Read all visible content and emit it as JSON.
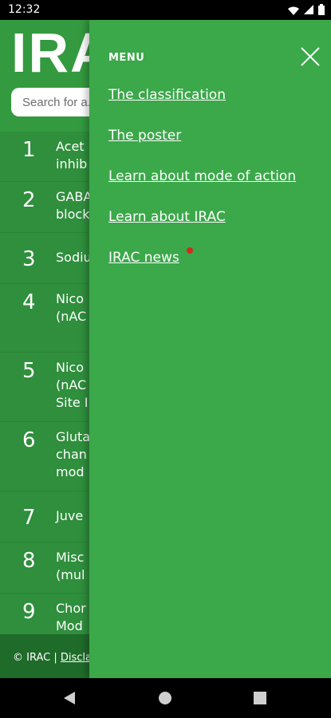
{
  "status": {
    "time": "12:32"
  },
  "header": {
    "logo_text": "IRAC",
    "search_placeholder": "Search for a..."
  },
  "list": [
    {
      "num": "1",
      "label_lines": [
        "Acet",
        "inhib"
      ]
    },
    {
      "num": "2",
      "label_lines": [
        "GABA",
        "block"
      ]
    },
    {
      "num": "3",
      "label_lines": [
        "Sodiu"
      ]
    },
    {
      "num": "4",
      "label_lines": [
        "Nico",
        "(nAC"
      ]
    },
    {
      "num": "5",
      "label_lines": [
        "Nico",
        "(nAC",
        "Site I"
      ]
    },
    {
      "num": "6",
      "label_lines": [
        "Gluta",
        "chan",
        "mod"
      ]
    },
    {
      "num": "7",
      "label_lines": [
        "Juve"
      ]
    },
    {
      "num": "8",
      "label_lines": [
        "Misc",
        "(mul"
      ]
    },
    {
      "num": "9",
      "label_lines": [
        "Chor",
        "Mod"
      ]
    }
  ],
  "footer": {
    "copyright": "© IRAC",
    "separator": "|",
    "disclaimer": "Discla"
  },
  "drawer": {
    "title": "MENU",
    "items": [
      {
        "label": "The classification"
      },
      {
        "label": "The poster"
      },
      {
        "label": "Learn about mode of action"
      },
      {
        "label": "Learn about IRAC"
      },
      {
        "label": "IRAC news",
        "has_badge": true
      }
    ]
  },
  "colors": {
    "background_green": "#2f8f3c",
    "drawer_green": "#3ba84a",
    "badge_red": "#d32a1f"
  }
}
